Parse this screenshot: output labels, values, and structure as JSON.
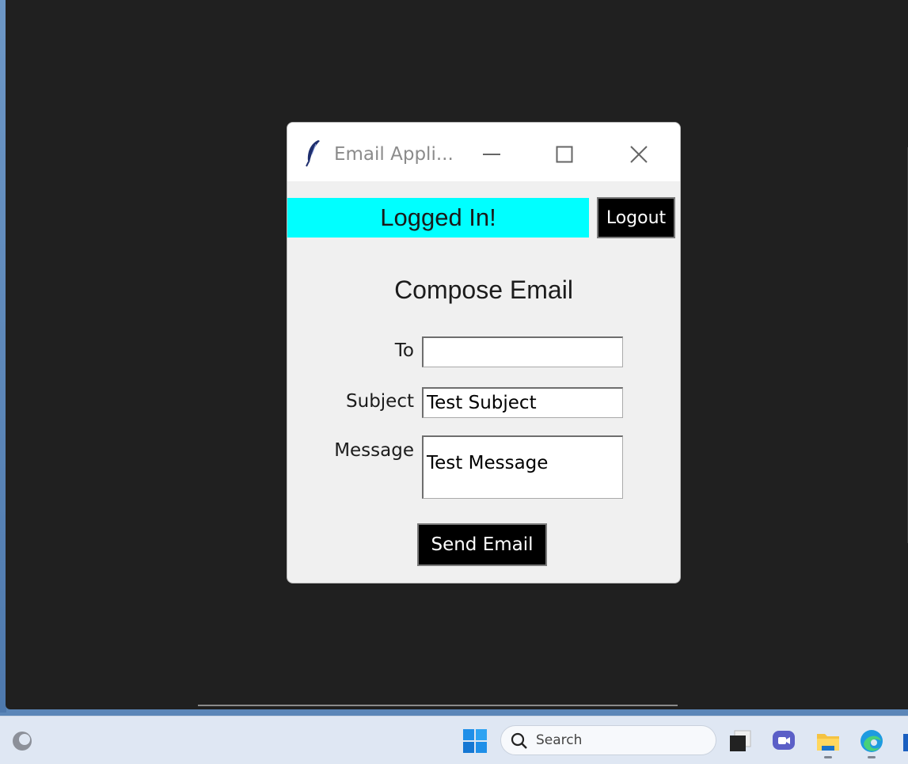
{
  "window": {
    "title": "Email Appli..."
  },
  "status": {
    "text": "Logged In!",
    "color": "#00ffff"
  },
  "buttons": {
    "logout": "Logout",
    "send": "Send Email"
  },
  "compose": {
    "title": "Compose Email",
    "to_label": "To",
    "to_value": "",
    "subject_label": "Subject",
    "subject_value": "Test Subject",
    "message_label": "Message",
    "message_value": "Test Message"
  },
  "taskbar": {
    "search_placeholder": "Search",
    "icons": [
      "app-icon",
      "windows-start-icon",
      "search-icon",
      "file-explorer-icon",
      "teams-icon",
      "folder-icon",
      "edge-icon"
    ]
  }
}
